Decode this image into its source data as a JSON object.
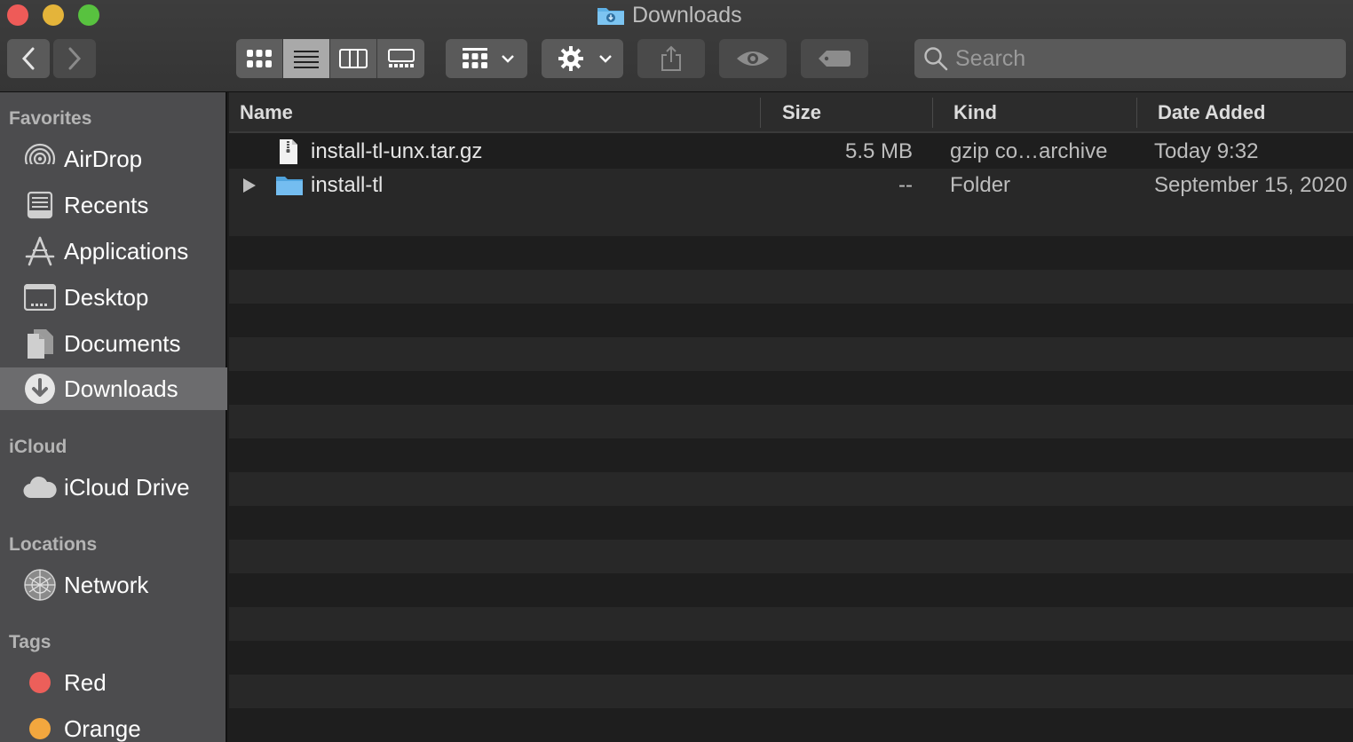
{
  "window": {
    "title": "Downloads"
  },
  "toolbar": {
    "back_icon": "chevron-left-icon",
    "forward_icon": "chevron-right-icon",
    "views": [
      "icon-view",
      "list-view",
      "column-view",
      "gallery-view"
    ],
    "active_view": "list-view",
    "search_placeholder": "Search"
  },
  "sidebar": {
    "favorites_title": "Favorites",
    "favorites": [
      {
        "label": "AirDrop",
        "icon": "airdrop-icon"
      },
      {
        "label": "Recents",
        "icon": "recents-icon"
      },
      {
        "label": "Applications",
        "icon": "applications-icon"
      },
      {
        "label": "Desktop",
        "icon": "desktop-icon"
      },
      {
        "label": "Documents",
        "icon": "documents-icon"
      },
      {
        "label": "Downloads",
        "icon": "downloads-icon",
        "selected": true
      }
    ],
    "icloud_title": "iCloud",
    "icloud": [
      {
        "label": "iCloud Drive",
        "icon": "cloud-icon"
      }
    ],
    "locations_title": "Locations",
    "locations": [
      {
        "label": "Network",
        "icon": "network-icon"
      }
    ],
    "tags_title": "Tags",
    "tags": [
      {
        "label": "Red",
        "color": "#ec5f5a"
      },
      {
        "label": "Orange",
        "color": "#f3a73e"
      }
    ]
  },
  "list": {
    "columns": [
      "Name",
      "Size",
      "Kind",
      "Date Added"
    ],
    "rows": [
      {
        "name": "install-tl-unx.tar.gz",
        "size": "5.5 MB",
        "kind": "gzip co…archive",
        "date_added": "Today 9:32",
        "icon": "archive-file-icon"
      },
      {
        "name": "install-tl",
        "size": "--",
        "kind": "Folder",
        "date_added": "September 15, 2020",
        "icon": "folder-icon"
      }
    ]
  }
}
